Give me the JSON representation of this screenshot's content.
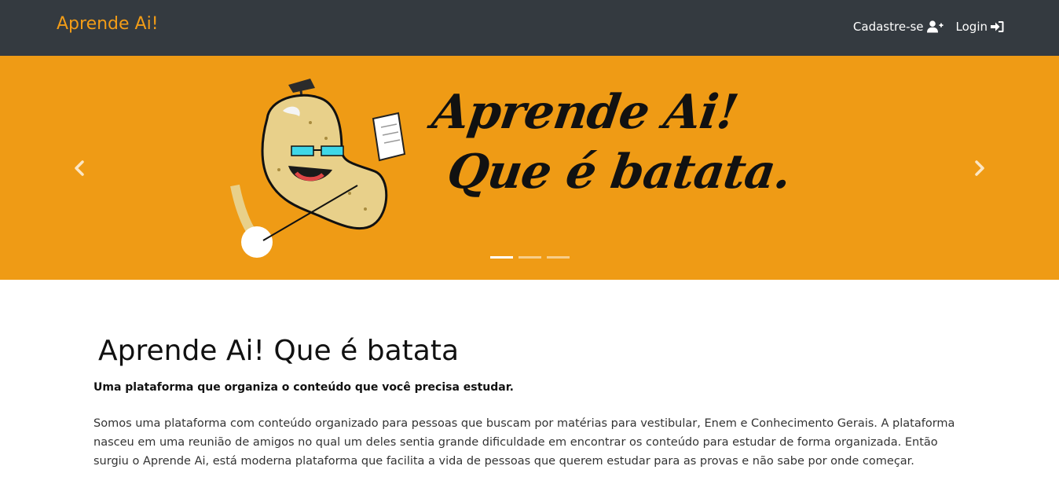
{
  "navbar": {
    "brand": "Aprende Ai!",
    "links": [
      {
        "label": "Cadastre-se",
        "icon": "user-plus-icon"
      },
      {
        "label": "Login",
        "icon": "sign-in-icon"
      }
    ]
  },
  "carousel": {
    "slide": {
      "slogan_line1": "Aprende Ai!",
      "slogan_line2": "Que é batata.",
      "background": "#ef9b15"
    },
    "prev_icon": "chevron-left-icon",
    "next_icon": "chevron-right-icon",
    "indicators": 3,
    "active_indicator": 1
  },
  "main": {
    "title": "Aprende Ai! Que é batata",
    "lead": "Uma plataforma que organiza o conteúdo que você precisa estudar.",
    "description": "Somos uma plataforma com conteúdo organizado para pessoas que buscam por matérias para vestibular, Enem e Conhecimento Gerais. A plataforma nasceu em uma reunião de amigos no qual um deles sentia grande dificuldade em encontrar os conteúdo para estudar de forma organizada. Então surgiu o Aprende Ai, está moderna plataforma que facilita a vida de pessoas que querem estudar para as provas e não sabe por onde começar."
  },
  "colors": {
    "navbar": "#343a40",
    "brand": "#f29c17",
    "banner": "#ef9b15"
  }
}
